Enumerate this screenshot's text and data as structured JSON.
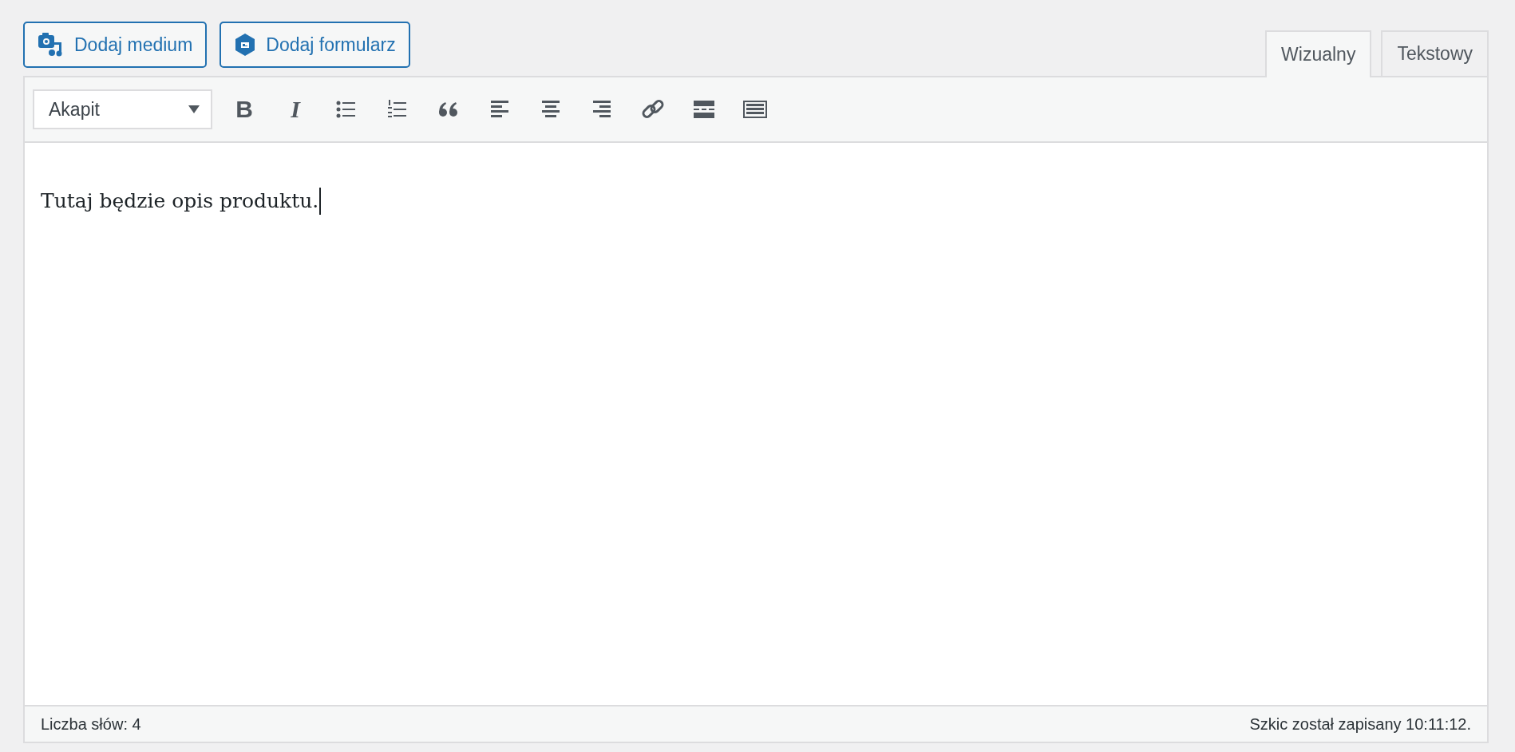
{
  "media_buttons": [
    {
      "kind": "media",
      "label": "Dodaj medium"
    },
    {
      "kind": "form",
      "label": "Dodaj formularz"
    }
  ],
  "tabs": [
    {
      "label": "Wizualny",
      "selected": true
    },
    {
      "label": "Tekstowy",
      "selected": false
    }
  ],
  "toolbar": {
    "format_select": {
      "value": "Akapit"
    },
    "buttons": [
      {
        "kind": "bold",
        "label": "B"
      },
      {
        "kind": "italic",
        "label": "I"
      },
      {
        "kind": "bullet-list"
      },
      {
        "kind": "numbered-list"
      },
      {
        "kind": "quote"
      },
      {
        "kind": "align-left"
      },
      {
        "kind": "align-center"
      },
      {
        "kind": "align-right"
      },
      {
        "kind": "link"
      },
      {
        "kind": "read-more"
      },
      {
        "kind": "toolbar-toggle"
      }
    ]
  },
  "content": {
    "text": "Tutaj będzie opis produktu."
  },
  "status_bar": {
    "word_count": "Liczba słów: 4",
    "autosave": "Szkic został zapisany 10:11:12."
  }
}
